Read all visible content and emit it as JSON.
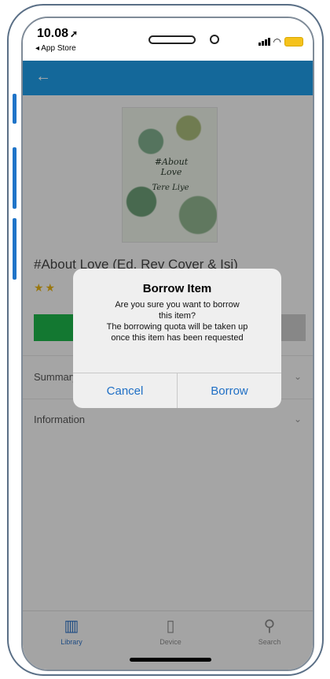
{
  "status_bar": {
    "time": "10.08",
    "back_app": "◂ App Store"
  },
  "book": {
    "title": "#About Love (Ed. Rev Cover & Isi)",
    "stars": "★★",
    "cover_title": "#About Love",
    "cover_author": "Tere Liye"
  },
  "sections": {
    "summary_label": "Summary",
    "information_label": "Information"
  },
  "dialog": {
    "title": "Borrow Item",
    "message": "Are you sure you want to borrow\nthis item?\nThe borrowing quota will be taken up\nonce this item has been requested",
    "cancel_label": "Cancel",
    "borrow_label": "Borrow"
  },
  "tabbar": {
    "library_label": "Library",
    "device_label": "Device",
    "search_label": "Search",
    "active_color": "#2f72c4",
    "inactive_color": "#8a8a8a"
  },
  "colors": {
    "app_bar": "#1e9be6",
    "primary_button": "#1db34a"
  }
}
